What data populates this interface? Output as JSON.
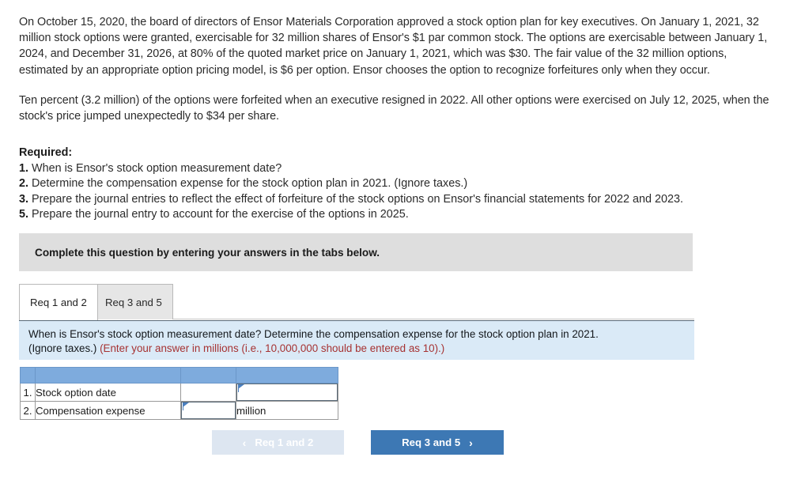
{
  "problem": {
    "paragraphs": [
      "On October 15, 2020, the board of directors of Ensor Materials Corporation approved a stock option plan for key executives. On January 1, 2021, 32 million stock options were granted, exercisable for 32 million shares of Ensor's $1 par common stock. The options are exercisable between January 1, 2024, and December 31, 2026, at 80% of the quoted market price on January 1, 2021, which was $30. The fair value of the 32 million options, estimated by an appropriate option pricing model, is $6 per option. Ensor chooses the option to recognize forfeitures only when they occur.",
      "Ten percent (3.2 million) of the options were forfeited when an executive resigned in 2022. All other options were exercised on July 12, 2025, when the stock's price jumped unexpectedly to $34 per share."
    ]
  },
  "required": {
    "title": "Required:",
    "items": [
      {
        "num": "1.",
        "text": "When is Ensor's stock option measurement date?"
      },
      {
        "num": "2.",
        "text": "Determine the compensation expense for the stock option plan in 2021. (Ignore taxes.)"
      },
      {
        "num": "3.",
        "text": "Prepare the journal entries to reflect the effect of forfeiture of the stock options on Ensor's financial statements for 2022 and 2023."
      },
      {
        "num": "5.",
        "text": "Prepare the journal entry to account for the exercise of the options in 2025."
      }
    ]
  },
  "banner": {
    "text": "Complete this question by entering your answers in the tabs below."
  },
  "tabs": [
    {
      "label": "Req 1 and 2",
      "active": true
    },
    {
      "label": "Req 3 and 5",
      "active": false
    }
  ],
  "instruction": {
    "line1_black": "When is Ensor's stock option measurement date? Determine the compensation expense for the stock option plan in 2021.",
    "line2_black": "(Ignore taxes.) ",
    "line2_red": "(Enter your answer in millions (i.e., 10,000,000 should be entered as 10).)"
  },
  "answer_table": {
    "header": [
      "",
      "",
      "",
      ""
    ],
    "rows": [
      {
        "num": "1.",
        "label": "Stock option date",
        "mid_value": "",
        "right_value": "",
        "input_column": "right"
      },
      {
        "num": "2.",
        "label": "Compensation expense",
        "mid_value": "",
        "right_value": "million",
        "input_column": "mid"
      }
    ]
  },
  "nav": {
    "prev_label": "Req 1 and 2",
    "prev_chevron": "‹",
    "next_label": "Req 3 and 5",
    "next_chevron": "›"
  },
  "colors": {
    "banner_gray": "#dedede",
    "panel_blue": "#daeaf7",
    "table_header_blue": "#7eabdd",
    "accent_blue": "#3d78b4",
    "disabled_blue": "#dde6f1",
    "red_text": "#a63232"
  }
}
